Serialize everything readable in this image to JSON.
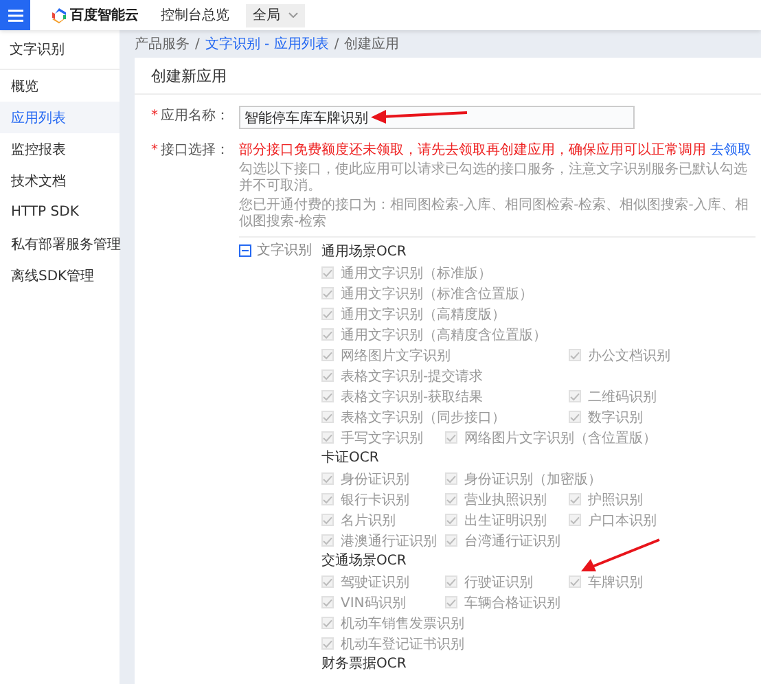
{
  "topbar": {
    "logo_text": "百度智能云",
    "nav_link": "控制台总览",
    "region_select": "全局"
  },
  "sidebar": {
    "title": "文字识别",
    "items": [
      {
        "label": "概览",
        "selected": false
      },
      {
        "label": "应用列表",
        "selected": true
      },
      {
        "label": "监控报表",
        "selected": false
      },
      {
        "label": "技术文档",
        "selected": false
      },
      {
        "label": "HTTP SDK",
        "selected": false
      },
      {
        "label": "私有部署服务管理",
        "selected": false
      },
      {
        "label": "离线SDK管理",
        "selected": false
      }
    ]
  },
  "breadcrumb": {
    "separator": "/",
    "items": [
      {
        "label": "产品服务",
        "link": false
      },
      {
        "label": "文字识别 - 应用列表",
        "link": true
      },
      {
        "label": "创建应用",
        "link": false
      }
    ]
  },
  "card": {
    "title": "创建新应用",
    "app_name": {
      "mark": "*",
      "label": "应用名称：",
      "value": "智能停车库车牌识别"
    },
    "api_select": {
      "mark": "*",
      "label": "接口选择：",
      "warning": "部分接口免费额度还未领取，请先去领取再创建应用，确保应用可以正常调用",
      "warning_link": "去领取",
      "hint": "勾选以下接口，使此应用可以请求已勾选的接口服务，注意文字识别服务已默认勾选并不可取消。",
      "paid_note": "您已开通付费的接口为：相同图检索-入库、相同图检索-检索、相似图搜索-入库、相似图搜索-检索",
      "tree": {
        "label": "文字识别",
        "indeterminate": true,
        "groups": [
          {
            "title": "通用场景OCR",
            "rows": [
              {
                "items": [
                  {
                    "label": "通用文字识别（标准版）",
                    "checked": true,
                    "disabled": true
                  }
                ]
              },
              {
                "items": [
                  {
                    "label": "通用文字识别（标准含位置版）",
                    "checked": true,
                    "disabled": true
                  }
                ]
              },
              {
                "items": [
                  {
                    "label": "通用文字识别（高精度版）",
                    "checked": true,
                    "disabled": true
                  }
                ]
              },
              {
                "items": [
                  {
                    "label": "通用文字识别（高精度含位置版）",
                    "checked": true,
                    "disabled": true
                  }
                ]
              },
              {
                "items": [
                  {
                    "label": "网络图片文字识别",
                    "checked": true,
                    "disabled": true
                  },
                  {
                    "label": "办公文档识别",
                    "checked": true,
                    "disabled": true
                  }
                ]
              },
              {
                "items": [
                  {
                    "label": "表格文字识别-提交请求",
                    "checked": true,
                    "disabled": true
                  }
                ]
              },
              {
                "items": [
                  {
                    "label": "表格文字识别-获取结果",
                    "checked": true,
                    "disabled": true
                  },
                  {
                    "label": "二维码识别",
                    "checked": true,
                    "disabled": true
                  }
                ]
              },
              {
                "items": [
                  {
                    "label": "表格文字识别（同步接口）",
                    "checked": true,
                    "disabled": true
                  },
                  {
                    "label": "数字识别",
                    "checked": true,
                    "disabled": true
                  }
                ]
              },
              {
                "items": [
                  {
                    "label": "手写文字识别",
                    "checked": true,
                    "disabled": true
                  },
                  {
                    "label": "网络图片文字识别（含位置版）",
                    "checked": true,
                    "disabled": true
                  }
                ]
              }
            ]
          },
          {
            "title": "卡证OCR",
            "rows": [
              {
                "items": [
                  {
                    "label": "身份证识别",
                    "checked": true,
                    "disabled": true
                  },
                  {
                    "label": "身份证识别（加密版）",
                    "checked": true,
                    "disabled": true
                  }
                ]
              },
              {
                "items": [
                  {
                    "label": "银行卡识别",
                    "checked": true,
                    "disabled": true
                  },
                  {
                    "label": "营业执照识别",
                    "checked": true,
                    "disabled": true
                  },
                  {
                    "label": "护照识别",
                    "checked": true,
                    "disabled": true
                  }
                ]
              },
              {
                "items": [
                  {
                    "label": "名片识别",
                    "checked": true,
                    "disabled": true
                  },
                  {
                    "label": "出生证明识别",
                    "checked": true,
                    "disabled": true
                  },
                  {
                    "label": "户口本识别",
                    "checked": true,
                    "disabled": true
                  }
                ]
              },
              {
                "items": [
                  {
                    "label": "港澳通行证识别",
                    "checked": true,
                    "disabled": true
                  },
                  {
                    "label": "台湾通行证识别",
                    "checked": true,
                    "disabled": true
                  }
                ]
              }
            ]
          },
          {
            "title": "交通场景OCR",
            "rows": [
              {
                "items": [
                  {
                    "label": "驾驶证识别",
                    "checked": true,
                    "disabled": true
                  },
                  {
                    "label": "行驶证识别",
                    "checked": true,
                    "disabled": true
                  },
                  {
                    "label": "车牌识别",
                    "checked": true,
                    "disabled": true
                  }
                ]
              },
              {
                "items": [
                  {
                    "label": "VIN码识别",
                    "checked": true,
                    "disabled": true
                  },
                  {
                    "label": "车辆合格证识别",
                    "checked": true,
                    "disabled": true
                  }
                ]
              },
              {
                "items": [
                  {
                    "label": "机动车销售发票识别",
                    "checked": true,
                    "disabled": true
                  }
                ]
              },
              {
                "items": [
                  {
                    "label": "机动车登记证书识别",
                    "checked": true,
                    "disabled": true
                  }
                ]
              }
            ]
          },
          {
            "title": "财务票据OCR"
          }
        ]
      }
    }
  }
}
